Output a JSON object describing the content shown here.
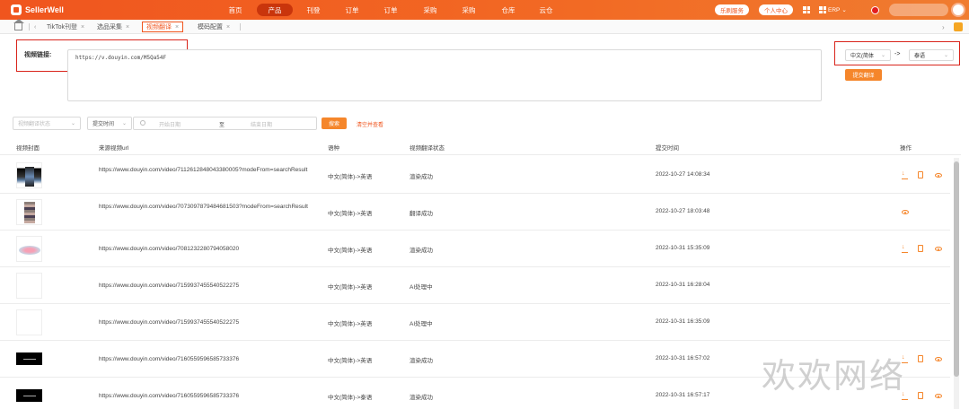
{
  "header": {
    "brand": "SellerWell",
    "nav": [
      "首页",
      "产品",
      "刊登",
      "订单",
      "订单",
      "采购",
      "采购",
      "仓库",
      "云仓"
    ],
    "active_nav": "产品",
    "service_pill": "乐刷服务",
    "personal_pill": "个人中心",
    "erp_label": "ERP"
  },
  "tabs": [
    {
      "label": "TikTok刊登",
      "closable": true
    },
    {
      "label": "选品采集",
      "closable": true
    },
    {
      "label": "视频翻译",
      "closable": true,
      "active": true
    },
    {
      "label": "模码配置",
      "closable": true
    }
  ],
  "form": {
    "video_label": "视频链接:",
    "video_url": "https://v.douyin.com/M5Qa54F",
    "source_lang": "中文(简体",
    "arrow": "->",
    "target_lang": "泰语",
    "submit_label": "提交翻译"
  },
  "filters": {
    "status_placeholder": "视频翻译状态",
    "time_label": "提交时间",
    "start_placeholder": "开始日期",
    "to": "至",
    "end_placeholder": "结束日期",
    "search_label": "搜索",
    "clear_label": "清空并查看"
  },
  "table": {
    "columns": [
      "视频封面",
      "来源视频url",
      "语种",
      "视频翻译状态",
      "提交时间",
      "操作"
    ],
    "rows": [
      {
        "url": "https://www.douyin.com/video/7112612848043380005?modeFrom=searchResult",
        "lang": "中文(简体)->英语",
        "status": "渲染成功",
        "time": "2022-10-27 14:08:34",
        "thumb": "a",
        "actions": [
          "download",
          "doc",
          "view"
        ]
      },
      {
        "url": "https://www.douyin.com/video/7073097879484681503?modeFrom=searchResult",
        "lang": "中文(简体)->英语",
        "status": "翻译成功",
        "time": "2022-10-27 18:03:48",
        "thumb": "b",
        "actions": [
          "view"
        ]
      },
      {
        "url": "https://www.douyin.com/video/7081232280794058020",
        "lang": "中文(简体)->英语",
        "status": "渲染成功",
        "time": "2022-10-31 15:35:09",
        "thumb": "c",
        "actions": [
          "download",
          "doc",
          "view"
        ]
      },
      {
        "url": "https://www.douyin.com/video/7159937455540522275",
        "lang": "中文(简体)->英语",
        "status": "AI处理中",
        "time": "2022-10-31 16:28:04",
        "thumb": "blank",
        "actions": []
      },
      {
        "url": "https://www.douyin.com/video/7159937455540522275",
        "lang": "中文(简体)->英语",
        "status": "AI处理中",
        "time": "2022-10-31 16:35:09",
        "thumb": "blank",
        "actions": []
      },
      {
        "url": "https://www.douyin.com/video/7160559596585733376",
        "lang": "中文(简体)->英语",
        "status": "渲染成功",
        "time": "2022-10-31 16:57:02",
        "thumb": "d",
        "actions": [
          "download",
          "doc",
          "view"
        ]
      },
      {
        "url": "https://www.douyin.com/video/7160559596585733376",
        "lang": "中文(简体)->泰语",
        "status": "渲染成功",
        "time": "2022-10-31 16:57:17",
        "thumb": "d",
        "actions": [
          "download",
          "doc",
          "view"
        ]
      }
    ]
  },
  "watermark": "欢欢网络",
  "colors": {
    "accent": "#f0551e",
    "button": "#f5862b",
    "highlight_box": "#d9241b"
  }
}
